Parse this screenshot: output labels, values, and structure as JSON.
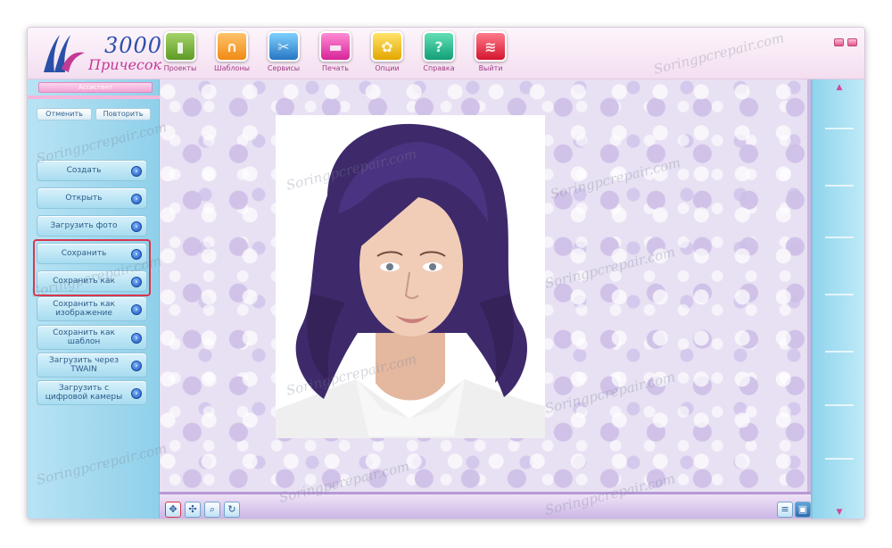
{
  "app": {
    "logo_number": "3000",
    "logo_subtitle": "Причесок"
  },
  "toolbar": {
    "items": [
      {
        "label": "Проекты",
        "icon": "projects-icon"
      },
      {
        "label": "Шаблоны",
        "icon": "templates-icon"
      },
      {
        "label": "Сервисы",
        "icon": "services-icon"
      },
      {
        "label": "Печать",
        "icon": "print-icon"
      },
      {
        "label": "Опции",
        "icon": "options-icon"
      },
      {
        "label": "Справка",
        "icon": "help-icon"
      },
      {
        "label": "Выйти",
        "icon": "exit-icon"
      }
    ]
  },
  "sidebar": {
    "assistant_label": "Ассистент",
    "undo_label": "Отменить",
    "redo_label": "Повторить",
    "items": [
      {
        "label": "Создать"
      },
      {
        "label": "Открыть"
      },
      {
        "label": "Загрузить фото"
      },
      {
        "label": "Сохранить"
      },
      {
        "label": "Сохранить как"
      },
      {
        "label": "Сохранить как изображение"
      },
      {
        "label": "Сохранить как шаблон"
      },
      {
        "label": "Загрузить через TWAIN"
      },
      {
        "label": "Загрузить с цифровой камеры"
      }
    ]
  },
  "watermark": "Soringpcrepair.com",
  "colors": {
    "accent": "#d9364c",
    "hair": "#3e2a6b",
    "panel": "#a7dcf0"
  }
}
